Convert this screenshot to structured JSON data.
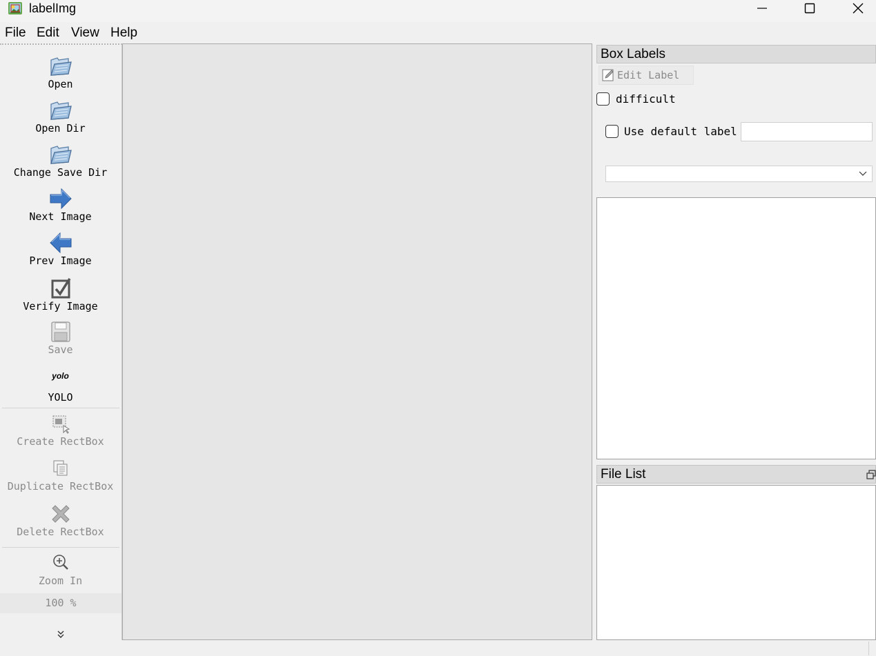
{
  "window": {
    "title": "labelImg"
  },
  "menu": [
    "File",
    "Edit",
    "View",
    "Help"
  ],
  "toolbar": {
    "open": "Open",
    "open_dir": "Open Dir",
    "change_save_dir": "Change Save Dir",
    "next_image": "Next Image",
    "prev_image": "Prev Image",
    "verify_image": "Verify Image",
    "save": "Save",
    "format_icon_text": "yolo",
    "format": "YOLO",
    "create_rectbox": "Create RectBox",
    "duplicate_rectbox": "Duplicate RectBox",
    "delete_rectbox": "Delete RectBox",
    "zoom_in": "Zoom In",
    "zoom_value": "100 %"
  },
  "box_labels": {
    "title": "Box Labels",
    "edit_label": "Edit Label",
    "difficult": "difficult",
    "difficult_checked": false,
    "use_default_label": "Use default label",
    "use_default_label_checked": false,
    "default_label_value": "",
    "combo_value": "",
    "labels": []
  },
  "file_list": {
    "title": "File List",
    "files": []
  },
  "colors": {
    "accent_arrow": "#3f78c4",
    "disabled_text": "#8a8a8a"
  }
}
